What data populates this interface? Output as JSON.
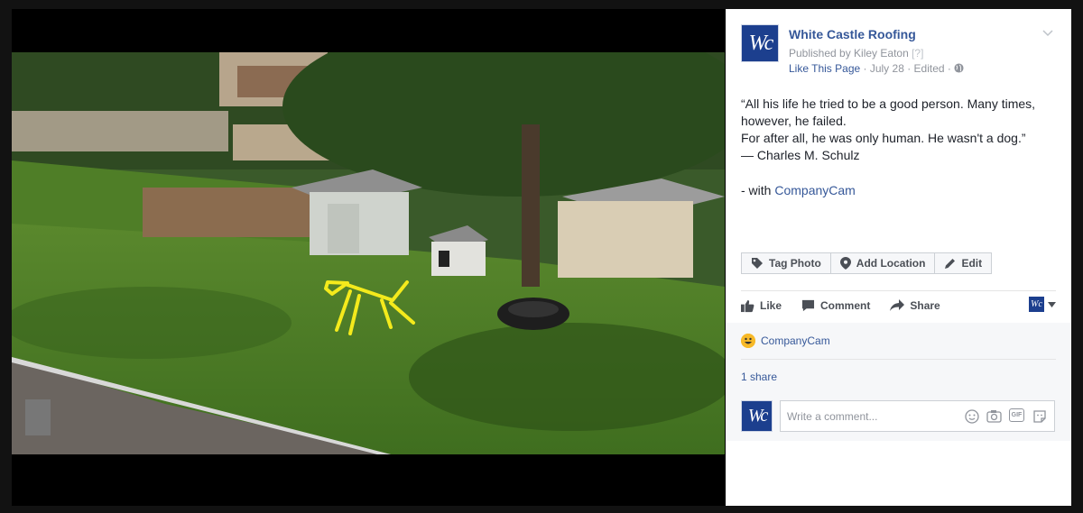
{
  "post": {
    "page_name": "White Castle Roofing",
    "published_by": "Published by Kiley Eaton",
    "help": "[?]",
    "like_page": "Like This Page",
    "date": "July 28",
    "edited": "Edited",
    "logo_text": "Wc",
    "quote_lines": [
      "“All his life he tried to be a good person. Many times, however, he failed.",
      "For after all, he was only human. He wasn't a dog.”",
      "— Charles M. Schulz"
    ],
    "with_prefix": "- with",
    "with_name": "CompanyCam"
  },
  "toolbar": {
    "tag_photo": "Tag Photo",
    "add_location": "Add Location",
    "edit": "Edit"
  },
  "actions": {
    "like": "Like",
    "comment": "Comment",
    "share": "Share"
  },
  "reactions": {
    "name": "CompanyCam",
    "shares": "1 share"
  },
  "comment": {
    "placeholder": "Write a comment...",
    "gif": "GIF"
  },
  "colors": {
    "link": "#365899",
    "brand_logo": "#1c3f8e",
    "doodle": "#f4ea1c"
  },
  "icons": [
    "chevron-down-icon",
    "globe-icon",
    "tag-icon",
    "location-pin-icon",
    "pencil-icon",
    "thumbs-up-icon",
    "comment-icon",
    "share-icon",
    "emoji-icon",
    "camera-icon",
    "gif-icon",
    "sticker-icon"
  ]
}
